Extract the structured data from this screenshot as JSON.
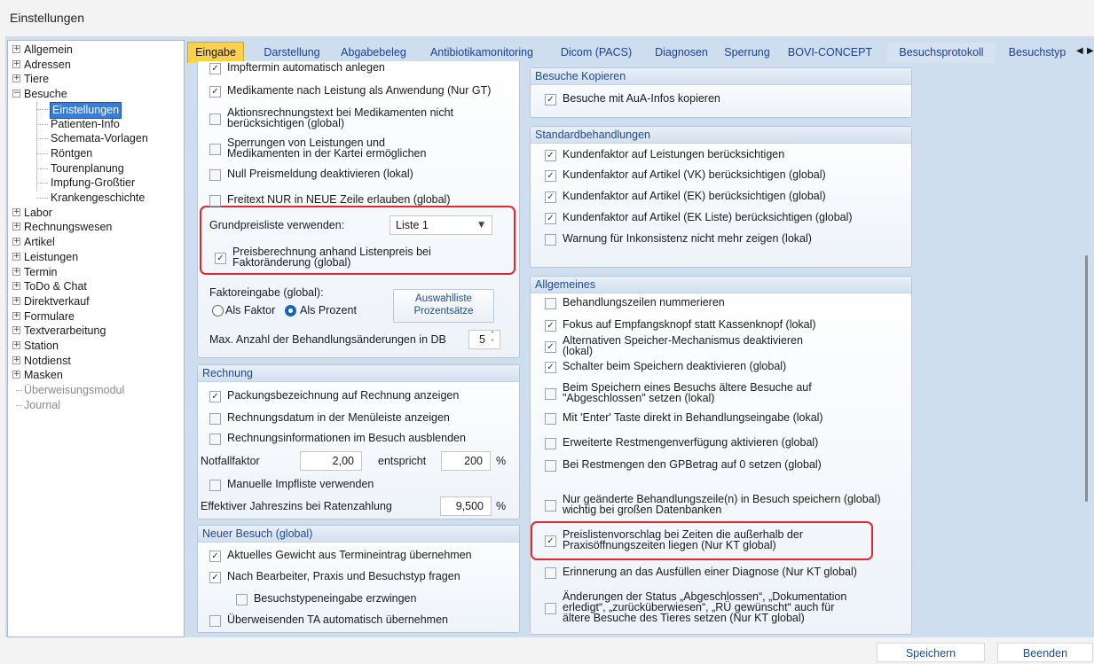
{
  "window": {
    "title": "Einstellungen"
  },
  "tree": [
    {
      "label": "Allgemein",
      "level": 0,
      "expander": "+"
    },
    {
      "label": "Adressen",
      "level": 0,
      "expander": "+"
    },
    {
      "label": "Tiere",
      "level": 0,
      "expander": "+"
    },
    {
      "label": "Besuche",
      "level": 0,
      "expander": "−"
    },
    {
      "label": "Einstellungen",
      "level": 1,
      "selected": true
    },
    {
      "label": "Patienten-Info",
      "level": 1
    },
    {
      "label": "Schemata-Vorlagen",
      "level": 1
    },
    {
      "label": "Röntgen",
      "level": 1
    },
    {
      "label": "Tourenplanung",
      "level": 1
    },
    {
      "label": "Impfung-Großtier",
      "level": 1
    },
    {
      "label": "Krankengeschichte",
      "level": 1
    },
    {
      "label": "Labor",
      "level": 0,
      "expander": "+"
    },
    {
      "label": "Rechnungswesen",
      "level": 0,
      "expander": "+"
    },
    {
      "label": "Artikel",
      "level": 0,
      "expander": "+"
    },
    {
      "label": "Leistungen",
      "level": 0,
      "expander": "+"
    },
    {
      "label": "Termin",
      "level": 0,
      "expander": "+"
    },
    {
      "label": "ToDo & Chat",
      "level": 0,
      "expander": "+"
    },
    {
      "label": "Direktverkauf",
      "level": 0,
      "expander": "+"
    },
    {
      "label": "Formulare",
      "level": 0,
      "expander": "+"
    },
    {
      "label": "Textverarbeitung",
      "level": 0,
      "expander": "+"
    },
    {
      "label": "Station",
      "level": 0,
      "expander": "+"
    },
    {
      "label": "Notdienst",
      "level": 0,
      "expander": "+"
    },
    {
      "label": "Masken",
      "level": 0,
      "expander": "+"
    },
    {
      "label": "Überweisungsmodul",
      "level": 0,
      "disabled": true
    },
    {
      "label": "Journal",
      "level": 0,
      "disabled": true
    }
  ],
  "tabs": [
    "Eingabe",
    "Darstellung",
    "Abgabebeleg",
    "Antibiotikamonitoring",
    "Dicom (PACS)",
    "Diagnosen",
    "Sperrung",
    "BOVI-CONCEPT",
    "Besuchsprotokoll",
    "Besuchstyp"
  ],
  "left": {
    "top_items": [
      {
        "text": "Impftermin automatisch anlegen",
        "checked": true
      },
      {
        "text": "Medikamente nach Leistung als Anwendung (Nur GT)",
        "checked": true
      },
      {
        "text": "Aktionsrechnungstext bei Medikamenten nicht\nberücksichtigen (global)",
        "checked": false
      },
      {
        "text": "Sperrungen von Leistungen und\nMedikamenten in der Kartei ermöglichen",
        "checked": false
      },
      {
        "text": "Null Preismeldung deaktivieren (lokal)",
        "checked": false
      },
      {
        "text": "Freitext NUR in NEUE Zeile erlauben (global)",
        "checked": false
      }
    ],
    "grundpreis_label": "Grundpreisliste verwenden:",
    "grundpreis_value": "Liste 1",
    "preisberechnung": {
      "text": "Preisberechnung anhand Listenpreis bei\nFaktoränderung (global)",
      "checked": true
    },
    "faktor_label": "Faktoreingabe (global):",
    "radio_faktor": "Als Faktor",
    "radio_prozent": "Als Prozent",
    "auswahl_btn": "Auswahlliste\nProzentsätze",
    "max_label": "Max. Anzahl der Behandlungsänderungen in DB",
    "max_value": "5",
    "rechnung": {
      "title": "Rechnung",
      "items": [
        {
          "text": "Packungsbezeichnung auf Rechnung anzeigen",
          "checked": true
        },
        {
          "text": "Rechnungsdatum in der Menüleiste anzeigen",
          "checked": false
        },
        {
          "text": "Rechnungsinformationen im Besuch ausblenden",
          "checked": false
        }
      ],
      "notfall_label": "Notfallfaktor",
      "notfall_value": "2,00",
      "entspricht": "entspricht",
      "prozent_value": "200",
      "percent": "%",
      "impfliste": {
        "text": "Manuelle Impfliste verwenden",
        "checked": false
      },
      "zins_label": "Effektiver Jahreszins bei Ratenzahlung",
      "zins_value": "9,500",
      "zins_percent": "%"
    },
    "neuer": {
      "title": "Neuer Besuch (global)",
      "items": [
        {
          "text": "Aktuelles Gewicht aus Termineintrag übernehmen",
          "checked": true
        },
        {
          "text": "Nach Bearbeiter, Praxis und Besuchstyp fragen",
          "checked": true
        },
        {
          "text": "Besuchstypeneingabe erzwingen",
          "checked": false
        },
        {
          "text": "Überweisenden TA automatisch übernehmen",
          "checked": false
        }
      ]
    }
  },
  "right": {
    "kopieren": {
      "title": "Besuche Kopieren",
      "items": [
        {
          "text": "Besuche mit AuA-Infos kopieren",
          "checked": true
        }
      ]
    },
    "standard": {
      "title": "Standardbehandlungen",
      "items": [
        {
          "text": "Kundenfaktor auf Leistungen berücksichtigen",
          "checked": true
        },
        {
          "text": "Kundenfaktor auf Artikel (VK) berücksichtigen (global)",
          "checked": true
        },
        {
          "text": "Kundenfaktor auf Artikel (EK) berücksichtigen (global)",
          "checked": true
        },
        {
          "text": "Kundenfaktor auf Artikel (EK Liste) berücksichtigen (global)",
          "checked": true
        },
        {
          "text": "Warnung für Inkonsistenz nicht mehr zeigen (lokal)",
          "checked": false
        }
      ]
    },
    "allgemein": {
      "title": "Allgemeines",
      "items": [
        {
          "text": "Behandlungszeilen nummerieren",
          "checked": false
        },
        {
          "text": "Fokus auf Empfangsknopf statt Kassenknopf (lokal)",
          "checked": true
        },
        {
          "text": "Alternativen Speicher-Mechanismus deaktivieren\n(lokal)",
          "checked": true
        },
        {
          "text": "Schalter beim Speichern deaktivieren (global)",
          "checked": true
        },
        {
          "text": "Beim Speichern eines Besuchs ältere Besuche auf\n\"Abgeschlossen\" setzen (lokal)",
          "checked": false
        },
        {
          "text": "Mit 'Enter' Taste direkt in Behandlungseingabe (lokal)",
          "checked": false
        },
        {
          "text": "Erweiterte Restmengenverfügung aktivieren (global)",
          "checked": false
        },
        {
          "text": "Bei Restmengen den GPBetrag auf 0 setzen (global)",
          "checked": false
        },
        {
          "text": "Nur geänderte Behandlungszeile(n) in Besuch speichern (global)\nwichtig bei großen Datenbanken",
          "checked": false
        },
        {
          "text": "Preislistenvorschlag bei Zeiten die außerhalb der\nPraxisöffnungszeiten liegen (Nur KT global)",
          "checked": true
        },
        {
          "text": "Erinnerung an das Ausfüllen einer Diagnose (Nur KT global)",
          "checked": false
        },
        {
          "text": "Änderungen der Status „Abgeschlossen“, „Dokumentation\nerledigt“, „zurücküberwiesen“, „RÜ gewünscht“ auch für\nältere Besuche des Tieres setzen (Nur KT global)",
          "checked": false
        }
      ]
    }
  },
  "buttons": {
    "save": "Speichern",
    "close": "Beenden"
  },
  "icons": {
    "tab_prev": "chevron-left-icon",
    "tab_next": "chevron-right-icon",
    "dropdown": "chevron-down-icon",
    "spinner": "spin-updown-icon",
    "check": "checkmark-icon"
  },
  "colors": {
    "active_tab": "#fad04c",
    "selection": "#3a7dd8",
    "highlight_box": "#e0282a",
    "panel_header_text": "#1d4b8f"
  }
}
